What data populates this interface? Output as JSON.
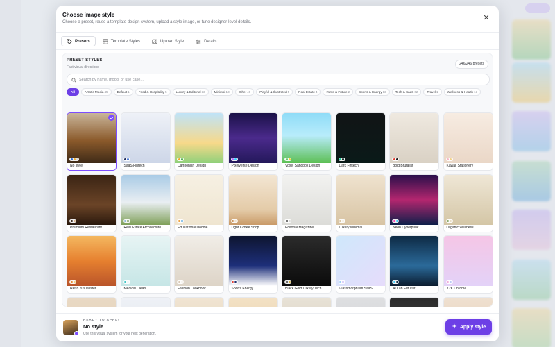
{
  "modal": {
    "title": "Choose image style",
    "subtitle": "Choose a preset, reuse a template design system, upload a style image, or tune designer-level details.",
    "close_icon": "close-icon"
  },
  "tabs": [
    {
      "label": "Presets",
      "icon": "tag-icon",
      "active": true
    },
    {
      "label": "Template Styles",
      "icon": "grid-icon",
      "active": false
    },
    {
      "label": "Upload Style",
      "icon": "image-upload-icon",
      "active": false
    },
    {
      "label": "Details",
      "icon": "sliders-icon",
      "active": false
    }
  ],
  "presets": {
    "title": "PRESET STYLES",
    "subtitle": "Fast visual directions",
    "count": "246/246 presets",
    "search_placeholder": "Search by name, mood, or use case..."
  },
  "chips": [
    {
      "label": "All",
      "count": "",
      "active": true
    },
    {
      "label": "Artistic Media",
      "count": "45"
    },
    {
      "label": "Default",
      "count": "1"
    },
    {
      "label": "Food & Hospitality",
      "count": "5"
    },
    {
      "label": "Luxury & Editorial",
      "count": "33"
    },
    {
      "label": "Minimal",
      "count": "13"
    },
    {
      "label": "Other",
      "count": "49"
    },
    {
      "label": "Playful & Illustrated",
      "count": "5"
    },
    {
      "label": "Real Estate",
      "count": "4"
    },
    {
      "label": "Retro & Future",
      "count": "2"
    },
    {
      "label": "Sports & Energy",
      "count": "13"
    },
    {
      "label": "Tech & SaaS",
      "count": "62"
    },
    {
      "label": "Travel",
      "count": "1"
    },
    {
      "label": "Wellness & Health",
      "count": "13"
    }
  ],
  "cards": [
    {
      "label": "No style",
      "selected": true,
      "colors": [
        "#2a6fdb",
        "#f2b33a",
        "#d8d8d8"
      ],
      "bg": "linear-gradient(180deg,#c9b59a 0%,#8b5a2b 55%,#3e2a17 100%)"
    },
    {
      "label": "SaaS Fintech",
      "colors": [
        "#1e2a5a",
        "#4a7bd8"
      ],
      "bg": "linear-gradient(180deg,#eef1f7,#cdd6e8)"
    },
    {
      "label": "Cartoonish Design",
      "colors": [
        "#f5a623",
        "#4caf50"
      ],
      "bg": "linear-gradient(180deg,#bfe3f7 0%,#f7d98a 60%,#8fd07a 100%)"
    },
    {
      "label": "Pixelverse Design",
      "colors": [
        "#b36bff",
        "#3ad1ff"
      ],
      "bg": "linear-gradient(180deg,#1b1248 0%,#4b2a8c 50%,#23185a 100%)"
    },
    {
      "label": "Voxel Sandbox Design",
      "colors": [
        "#5ec46a",
        "#f2d43a"
      ],
      "bg": "linear-gradient(180deg,#8fdcf7 0%,#b8ecfb 45%,#5cbf54 100%)"
    },
    {
      "label": "Dark Fintech",
      "colors": [
        "#1fd1a1",
        "#0f2a24"
      ],
      "bg": "linear-gradient(180deg,#111416,#0a1a18)"
    },
    {
      "label": "Bold Brutalist",
      "colors": [
        "#e23b2e",
        "#1a1a1a"
      ],
      "bg": "linear-gradient(180deg,#efe9e0,#d9d1c4)"
    },
    {
      "label": "Kawaii Stationery",
      "colors": [
        "#f7b6c8",
        "#f2d28a"
      ],
      "bg": "linear-gradient(180deg,#f7ece2,#ead7c7)"
    },
    {
      "label": "Premium Restaurant",
      "colors": [
        "#3a2618",
        "#d9b48a"
      ],
      "bg": "linear-gradient(180deg,#3a2414 0%,#6b4427 60%,#2a190d 100%)"
    },
    {
      "label": "Real Estate Architecture",
      "colors": [
        "#8fb8d8",
        "#6c8f4a"
      ],
      "bg": "linear-gradient(180deg,#a9cbe6 0%,#e9eef2 55%,#7fa05a 100%)"
    },
    {
      "label": "Educational Doodle",
      "colors": [
        "#f2a03a",
        "#4aa3e0"
      ],
      "bg": "linear-gradient(180deg,#f6f0e3,#efe5d0)"
    },
    {
      "label": "Light Coffee Shop",
      "colors": [
        "#c8925a",
        "#f2e2cc"
      ],
      "bg": "linear-gradient(180deg,#f3e6d3 0%,#e4cba8 70%,#c99a68 100%)"
    },
    {
      "label": "Editorial Magazine",
      "colors": [
        "#1a1a1a",
        "#d8d8d8"
      ],
      "bg": "linear-gradient(180deg,#f2f2f0,#dcdcd8)"
    },
    {
      "label": "Luxury Minimal",
      "colors": [
        "#d9c3a0",
        "#f1e7d6"
      ],
      "bg": "linear-gradient(180deg,#efe3cf,#d8c4a4)"
    },
    {
      "label": "Neon Cyberpunk",
      "colors": [
        "#ff3fb4",
        "#3ad1ff"
      ],
      "bg": "linear-gradient(180deg,#2a0f4a 0%,#b3266f 50%,#0f1f4a 100%)"
    },
    {
      "label": "Organic Wellness",
      "colors": [
        "#8aa86a",
        "#e8dcc4"
      ],
      "bg": "linear-gradient(180deg,#efe7d6,#d4c6a6)"
    },
    {
      "label": "Retro 70s Poster",
      "colors": [
        "#e8862a",
        "#f2d07a"
      ],
      "bg": "linear-gradient(180deg,#f4b860 0%,#e6802f 50%,#b9542a 100%)"
    },
    {
      "label": "Medical Clean",
      "colors": [
        "#3ac4c4",
        "#e6f6f6"
      ],
      "bg": "linear-gradient(180deg,#e7f4f4,#c6e6e6)"
    },
    {
      "label": "Fashion Lookbook",
      "colors": [
        "#d8c8b4",
        "#f3eee8"
      ],
      "bg": "linear-gradient(180deg,#f1ede7,#ddd4c7)"
    },
    {
      "label": "Sports Energy",
      "colors": [
        "#e23b2e",
        "#1a2a6a"
      ],
      "bg": "linear-gradient(180deg,#0e1530 0%,#1d2f7a 60%,#ffffff 100%)"
    },
    {
      "label": "Black Gold Luxury Tech",
      "colors": [
        "#1a1a1a",
        "#d4af37"
      ],
      "bg": "linear-gradient(180deg,#2b2b2b,#0b0b0b)"
    },
    {
      "label": "Glassmorphism SaaS",
      "colors": [
        "#9ad0f5",
        "#c9b6f7"
      ],
      "bg": "linear-gradient(135deg,#cfe8fb,#e6dcfb)"
    },
    {
      "label": "AI Lab Futurist",
      "colors": [
        "#3ad1ff",
        "#0b2440"
      ],
      "bg": "linear-gradient(180deg,#0e2a44 0%,#2b6a9a 60%,#0b1b2e 100%)"
    },
    {
      "label": "Y2K Chrome",
      "colors": [
        "#f2a9d8",
        "#b8c8f5"
      ],
      "bg": "linear-gradient(180deg,#f5c6e6,#e3d2f8)"
    },
    {
      "label": "",
      "colors": [],
      "bg": "linear-gradient(180deg,#e9d9c4,#e2cfb6)"
    },
    {
      "label": "",
      "colors": [],
      "bg": "linear-gradient(180deg,#eef1f6,#e1e5ec)"
    },
    {
      "label": "",
      "colors": [],
      "bg": "linear-gradient(180deg,#f0e4d2,#e6d6bd)"
    },
    {
      "label": "",
      "colors": [],
      "bg": "linear-gradient(180deg,#f3e1c4,#e6d0ac)"
    },
    {
      "label": "",
      "colors": [],
      "bg": "linear-gradient(180deg,#e8e2d6,#d6cebe)"
    },
    {
      "label": "",
      "colors": [],
      "bg": "linear-gradient(180deg,#dedfe1,#cfd1d4)"
    },
    {
      "label": "",
      "colors": [],
      "bg": "linear-gradient(180deg,#2b2b2b,#4a4a4a)"
    },
    {
      "label": "",
      "colors": [],
      "bg": "linear-gradient(180deg,#efe0d0,#e3cfb8)"
    }
  ],
  "footer": {
    "ready_label": "READY TO APPLY",
    "style_name": "No style",
    "description": "Use this visual system for your next generation.",
    "apply_label": "Apply style",
    "apply_icon": "sparkle-icon"
  },
  "colors": {
    "accent": "#6d3fe6",
    "selection": "#7c4dff"
  }
}
